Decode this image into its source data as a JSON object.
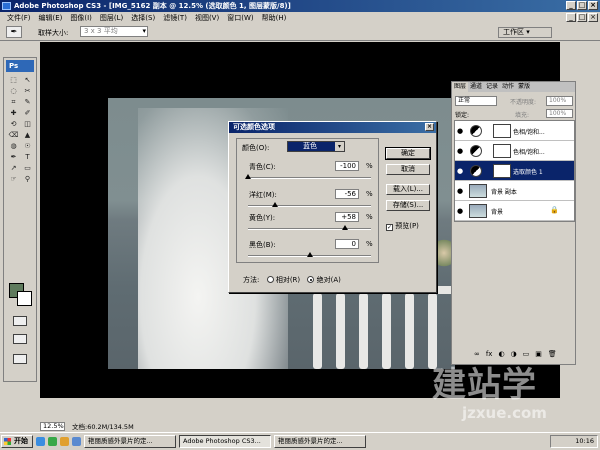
{
  "window": {
    "title": "Adobe Photoshop CS3 - [IMG_5162 副本 @ 12.5% (选取颜色 1, 图层蒙版/8)]",
    "controls": [
      "_",
      "□",
      "×"
    ]
  },
  "menu": [
    "文件(F)",
    "编辑(E)",
    "图像(I)",
    "图层(L)",
    "选择(S)",
    "滤镜(T)",
    "视图(V)",
    "窗口(W)",
    "帮助(H)"
  ],
  "options": {
    "tool_glyph": "✒",
    "sample_label": "取样大小:",
    "sample_value": "3 x 3 平均",
    "workspace": "工作区 ▾"
  },
  "toolbox": {
    "logo": "Ps",
    "tools": [
      "⬚",
      "↖",
      "◌",
      "✂",
      "⌗",
      "✎",
      "✚",
      "✐",
      "⟲",
      "◫",
      "⌫",
      "▲",
      "◍",
      "☉",
      "✒",
      "T",
      "↗",
      "▭",
      "☞",
      "⚲"
    ]
  },
  "colors": {
    "foreground": "#5e7a5c",
    "background": "#ffffff"
  },
  "dialog": {
    "title": "可选颜色选项",
    "close": "×",
    "color_label": "颜色(O):",
    "color_value": "蓝色",
    "arrow": "▾",
    "sliders": [
      {
        "label": "青色(C):",
        "value": "-100",
        "unit": "%",
        "percent": -100
      },
      {
        "label": "洋红(M):",
        "value": "-56",
        "unit": "%",
        "percent": -56
      },
      {
        "label": "黄色(Y):",
        "value": "+58",
        "unit": "%",
        "percent": 58
      },
      {
        "label": "黑色(B):",
        "value": "0",
        "unit": "%",
        "percent": 0
      }
    ],
    "buttons": {
      "ok": "确定",
      "cancel": "取消",
      "load": "载入(L)...",
      "save": "存储(S)..."
    },
    "preview_check": "✓",
    "preview_label": "预览(P)",
    "method_label": "方法:",
    "method_relative": "相对(R)",
    "method_absolute": "绝对(A)"
  },
  "layers_panel": {
    "tabs": [
      "图层",
      "通道",
      "记录",
      "动作",
      "蒙版"
    ],
    "blend_mode": "正常",
    "opacity_label": "不透明度:",
    "opacity_value": "100%",
    "lock_label": "锁定:",
    "fill_label": "填充:",
    "fill_value": "100%",
    "eye": "●",
    "lock_icon": "🔒",
    "layers": [
      {
        "name": "色相/饱和...",
        "selected": false
      },
      {
        "name": "色相/饱和...",
        "selected": false
      },
      {
        "name": "选取颜色 1",
        "selected": true
      },
      {
        "name": "背景 副本",
        "selected": false
      },
      {
        "name": "背景",
        "selected": false
      }
    ],
    "footer_icons": [
      "∞",
      "fx",
      "◐",
      "◑",
      "▭",
      "▣",
      "🗑"
    ]
  },
  "status": {
    "zoom": "12.5%",
    "doc": "文档:60.2M/134.5M"
  },
  "taskbar": {
    "start": "开始",
    "tasks": [
      "艳丽质感外景片的定...",
      "Adobe Photoshop CS3...",
      "艳丽质感外景片的定..."
    ],
    "clock": "10:16"
  },
  "watermark": {
    "brand": "建站学",
    "url": "jzxue.com"
  }
}
